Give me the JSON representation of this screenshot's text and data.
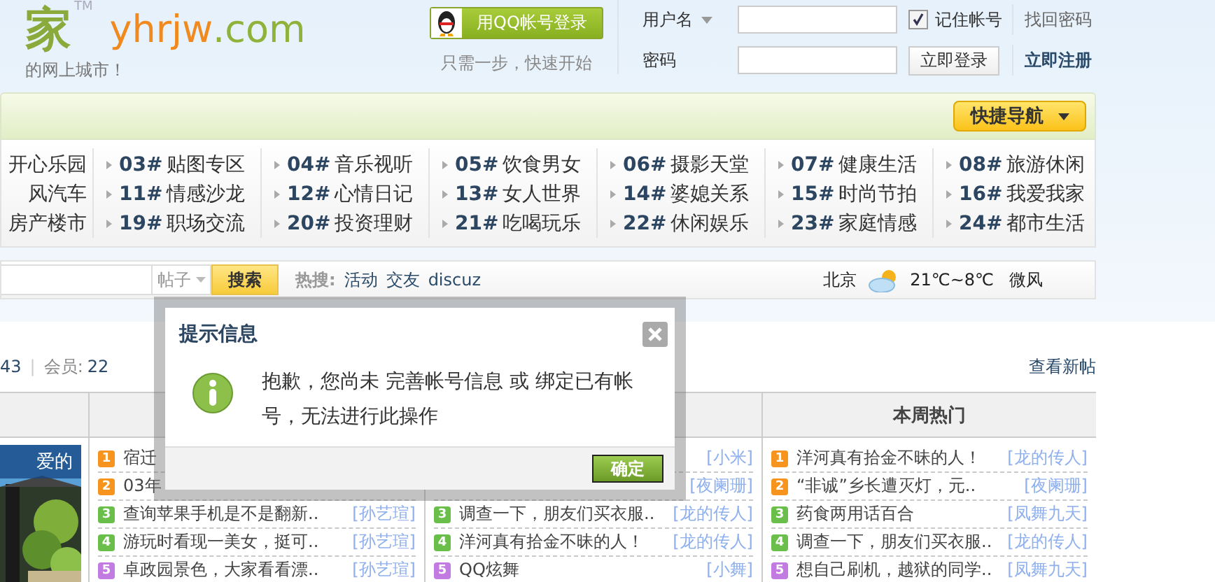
{
  "header": {
    "logo": {
      "character": "家",
      "trademark": "TM",
      "domain_name": "yhrjw",
      "domain_suffix": ".com",
      "tagline": "的网上城市！"
    },
    "qq_login": {
      "label": "用QQ帐号登录",
      "hint": "只需一步，快速开始"
    }
  },
  "login": {
    "username_label": "用户名",
    "password_label": "密码",
    "remember": {
      "label": "记住帐号",
      "checked": true
    },
    "forgot_password": "找回密码",
    "submit": "立即登录",
    "register": "立即注册"
  },
  "quick_nav": "快捷导航",
  "forums": [
    {
      "items": [
        {
          "name": "开心乐园"
        },
        {
          "name": "风汽车"
        },
        {
          "name": "房产楼市"
        }
      ]
    },
    {
      "items": [
        {
          "code": "03#",
          "name": "贴图专区"
        },
        {
          "code": "11#",
          "name": "情感沙龙"
        },
        {
          "code": "19#",
          "name": "职场交流"
        }
      ]
    },
    {
      "items": [
        {
          "code": "04#",
          "name": "音乐视听"
        },
        {
          "code": "12#",
          "name": "心情日记"
        },
        {
          "code": "20#",
          "name": "投资理财"
        }
      ]
    },
    {
      "items": [
        {
          "code": "05#",
          "name": "饮食男女"
        },
        {
          "code": "13#",
          "name": "女人世界"
        },
        {
          "code": "21#",
          "name": "吃喝玩乐"
        }
      ]
    },
    {
      "items": [
        {
          "code": "06#",
          "name": "摄影天堂"
        },
        {
          "code": "14#",
          "name": "婆媳关系"
        },
        {
          "code": "22#",
          "name": "休闲娱乐"
        }
      ]
    },
    {
      "items": [
        {
          "code": "07#",
          "name": "健康生活"
        },
        {
          "code": "15#",
          "name": "时尚节拍"
        },
        {
          "code": "23#",
          "name": "家庭情感"
        }
      ]
    },
    {
      "items": [
        {
          "code": "08#",
          "name": "旅游休闲"
        },
        {
          "code": "16#",
          "name": "我爱我家"
        },
        {
          "code": "24#",
          "name": "都市生活"
        }
      ]
    }
  ],
  "search": {
    "scope": "帖子",
    "button": "搜索",
    "hot_label": "热搜:",
    "hot_terms": [
      "活动",
      "交友",
      "discuz"
    ]
  },
  "weather": {
    "city": "北京",
    "temperature": "21℃~8℃",
    "wind": "微风"
  },
  "stats": {
    "value": "43",
    "separator": "|",
    "members_label": "会员:",
    "members": "22"
  },
  "new_posts_link": "查看新帖",
  "table": {
    "column_4_heading": "本周热门",
    "picture": {
      "caption": "爱的"
    },
    "lists": [
      {
        "items": [
          {
            "rank": "1",
            "color": "#f7941d",
            "title": "宿迁"
          },
          {
            "rank": "2",
            "color": "#f7941d",
            "title": "03年"
          },
          {
            "rank": "3",
            "color": "#6abf4b",
            "title": "查询苹果手机是不是翻新..",
            "author": "[孙艺瑄]"
          },
          {
            "rank": "4",
            "color": "#6abf4b",
            "title": "游玩时看现一美女，挺可..",
            "author": "[孙艺瑄]"
          },
          {
            "rank": "5",
            "color": "#c27be0",
            "title": "卓政园景色，大家看看漂..",
            "author": "[孙艺瑄]"
          }
        ]
      },
      {
        "items": [
          {
            "author": "[小米]"
          },
          {
            "author": "[夜阑珊]"
          },
          {
            "rank": "3",
            "color": "#6abf4b",
            "title": "调查一下，朋友们买衣服..",
            "author": "[龙的传人]"
          },
          {
            "rank": "4",
            "color": "#6abf4b",
            "title": "洋河真有拾金不昧的人！",
            "author": "[龙的传人]"
          },
          {
            "rank": "5",
            "color": "#c27be0",
            "title": "QQ炫舞",
            "author": "[小舞]"
          }
        ]
      },
      {
        "items": [
          {
            "rank": "1",
            "color": "#f7941d",
            "title": "洋河真有拾金不昧的人！",
            "author": "[龙的传人]"
          },
          {
            "rank": "2",
            "color": "#f7941d",
            "title": "“非诚”乡长遭灭灯，元..",
            "author": "[夜阑珊]"
          },
          {
            "rank": "3",
            "color": "#6abf4b",
            "title": "药食两用话百合",
            "author": "[凤舞九天]"
          },
          {
            "rank": "4",
            "color": "#6abf4b",
            "title": "调查一下，朋友们买衣服..",
            "author": "[龙的传人]"
          },
          {
            "rank": "5",
            "color": "#c27be0",
            "title": "想自己刷机，越狱的同学..",
            "author": "[凤舞九天]"
          }
        ]
      }
    ]
  },
  "dialog": {
    "title": "提示信息",
    "message": "抱歉，您尚未 完善帐号信息 或 绑定已有帐号，无法进行此操作",
    "button": "确定"
  }
}
